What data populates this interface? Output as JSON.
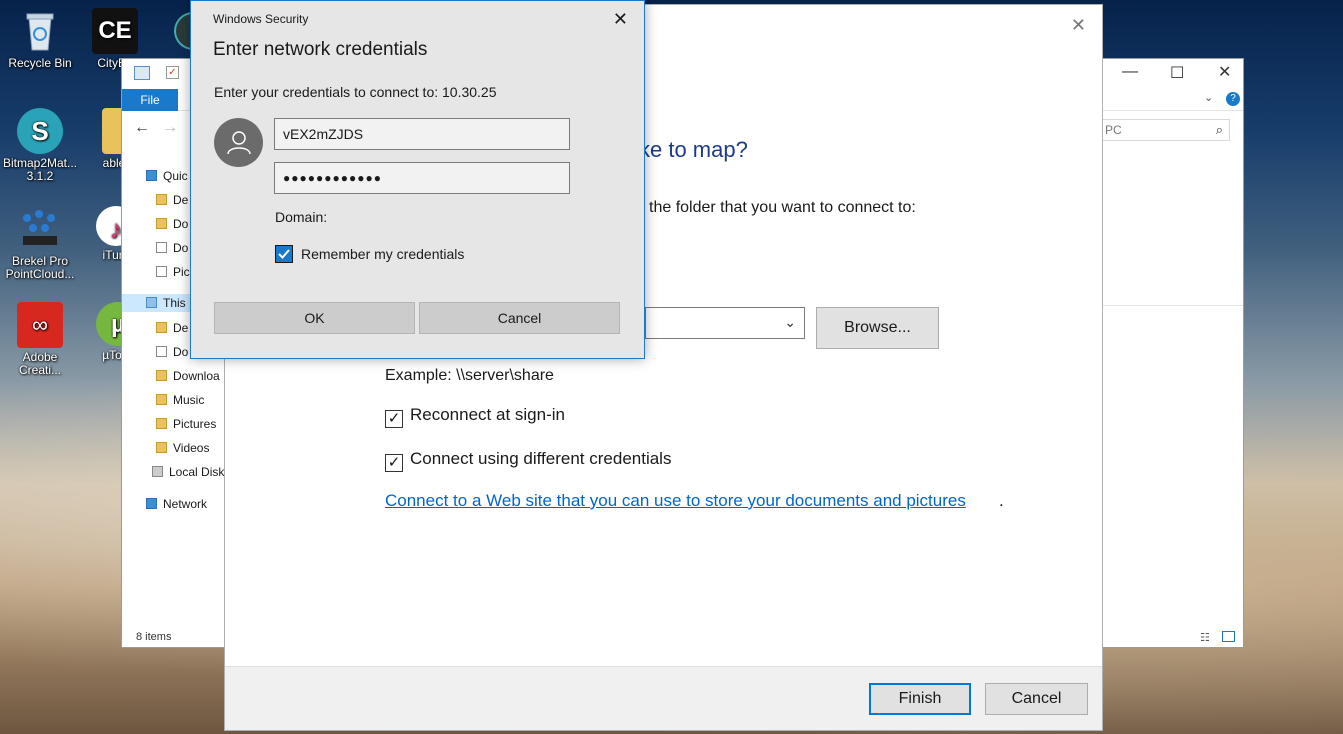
{
  "desktop": {
    "icons": [
      {
        "label": "Recycle Bin"
      },
      {
        "label": "CityEn"
      },
      {
        "label": "Bitmap2Mat... 3.1.2"
      },
      {
        "label": "able"
      },
      {
        "label": "Brekel Pro PointCloud..."
      },
      {
        "label": "iTun"
      },
      {
        "label": "Adobe Creati..."
      },
      {
        "label": "µTor"
      }
    ],
    "ce_logo": "CE"
  },
  "explorer": {
    "file_tab": "File",
    "search_placeholder": "PC",
    "sidebar": [
      {
        "label": "Quic"
      },
      {
        "label": "De"
      },
      {
        "label": "Do"
      },
      {
        "label": "Do"
      },
      {
        "label": "Pic"
      },
      {
        "label": "This"
      },
      {
        "label": "De"
      },
      {
        "label": "Do"
      },
      {
        "label": "Downloa"
      },
      {
        "label": "Music"
      },
      {
        "label": "Pictures"
      },
      {
        "label": "Videos"
      },
      {
        "label": "Local Disk"
      },
      {
        "label": "Network"
      }
    ],
    "status": "8 items"
  },
  "map_dialog": {
    "heading": "ke to map?",
    "intro": "the folder that you want to connect to:",
    "browse_label": "Browse...",
    "example": "Example: \\\\server\\share",
    "reconnect_label": "Reconnect at sign-in",
    "different_creds_label": "Connect using different credentials",
    "weblink": "Connect to a Web site that you can use to store your documents and pictures",
    "weblink_end": ".",
    "finish_label": "Finish",
    "cancel_label": "Cancel",
    "reconnect_checked": true,
    "different_creds_checked": true
  },
  "security_dialog": {
    "brand": "Windows Security",
    "title": "Enter network credentials",
    "subtitle": "Enter your credentials to connect to: 10.30.25",
    "username_value": "vEX2mZJDS",
    "password_value": "●●●●●●●●●●●●",
    "domain_label": "Domain:",
    "remember_label": "Remember my credentials",
    "remember_checked": true,
    "ok_label": "OK",
    "cancel_label": "Cancel",
    "accent_color": "#1979ca"
  }
}
